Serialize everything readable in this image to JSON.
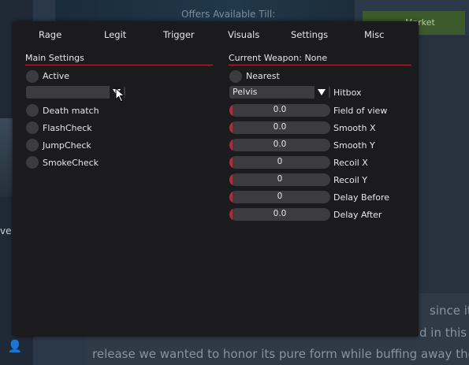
{
  "background": {
    "offer_text": "Offers Available Till:",
    "market_label": "Market",
    "left_text": "ve",
    "article_lines": [
      "since its",
      "d in this n",
      "release we wanted to honor its pure form while buffing away the"
    ]
  },
  "tabs": [
    "Rage",
    "Legit",
    "Trigger",
    "Visuals",
    "Settings",
    "Misc"
  ],
  "main_settings": {
    "title": "Main Settings",
    "active_label": "Active",
    "dropdown_value": "",
    "checks": [
      "Death match",
      "FlashCheck",
      "JumpCheck",
      "SmokeCheck"
    ]
  },
  "weapon": {
    "title": "Current Weapon: None",
    "nearest_label": "Nearest",
    "hitbox_value": "Pelvis",
    "hitbox_label": "Hitbox",
    "sliders": [
      {
        "label": "Field of view",
        "value": "0.0"
      },
      {
        "label": "Smooth X",
        "value": "0.0"
      },
      {
        "label": "Smooth Y",
        "value": "0.0"
      },
      {
        "label": "Recoil X",
        "value": "0"
      },
      {
        "label": "Recoil Y",
        "value": "0"
      },
      {
        "label": "Delay Before",
        "value": "0"
      },
      {
        "label": "Delay After",
        "value": "0.0"
      }
    ]
  },
  "colors": {
    "accent": "#b12a3a",
    "panel": "#1b1b1d",
    "control": "#3c3c40"
  },
  "icons": [
    "user-add-icon",
    "caret-down-icon",
    "mouse-cursor-icon"
  ]
}
